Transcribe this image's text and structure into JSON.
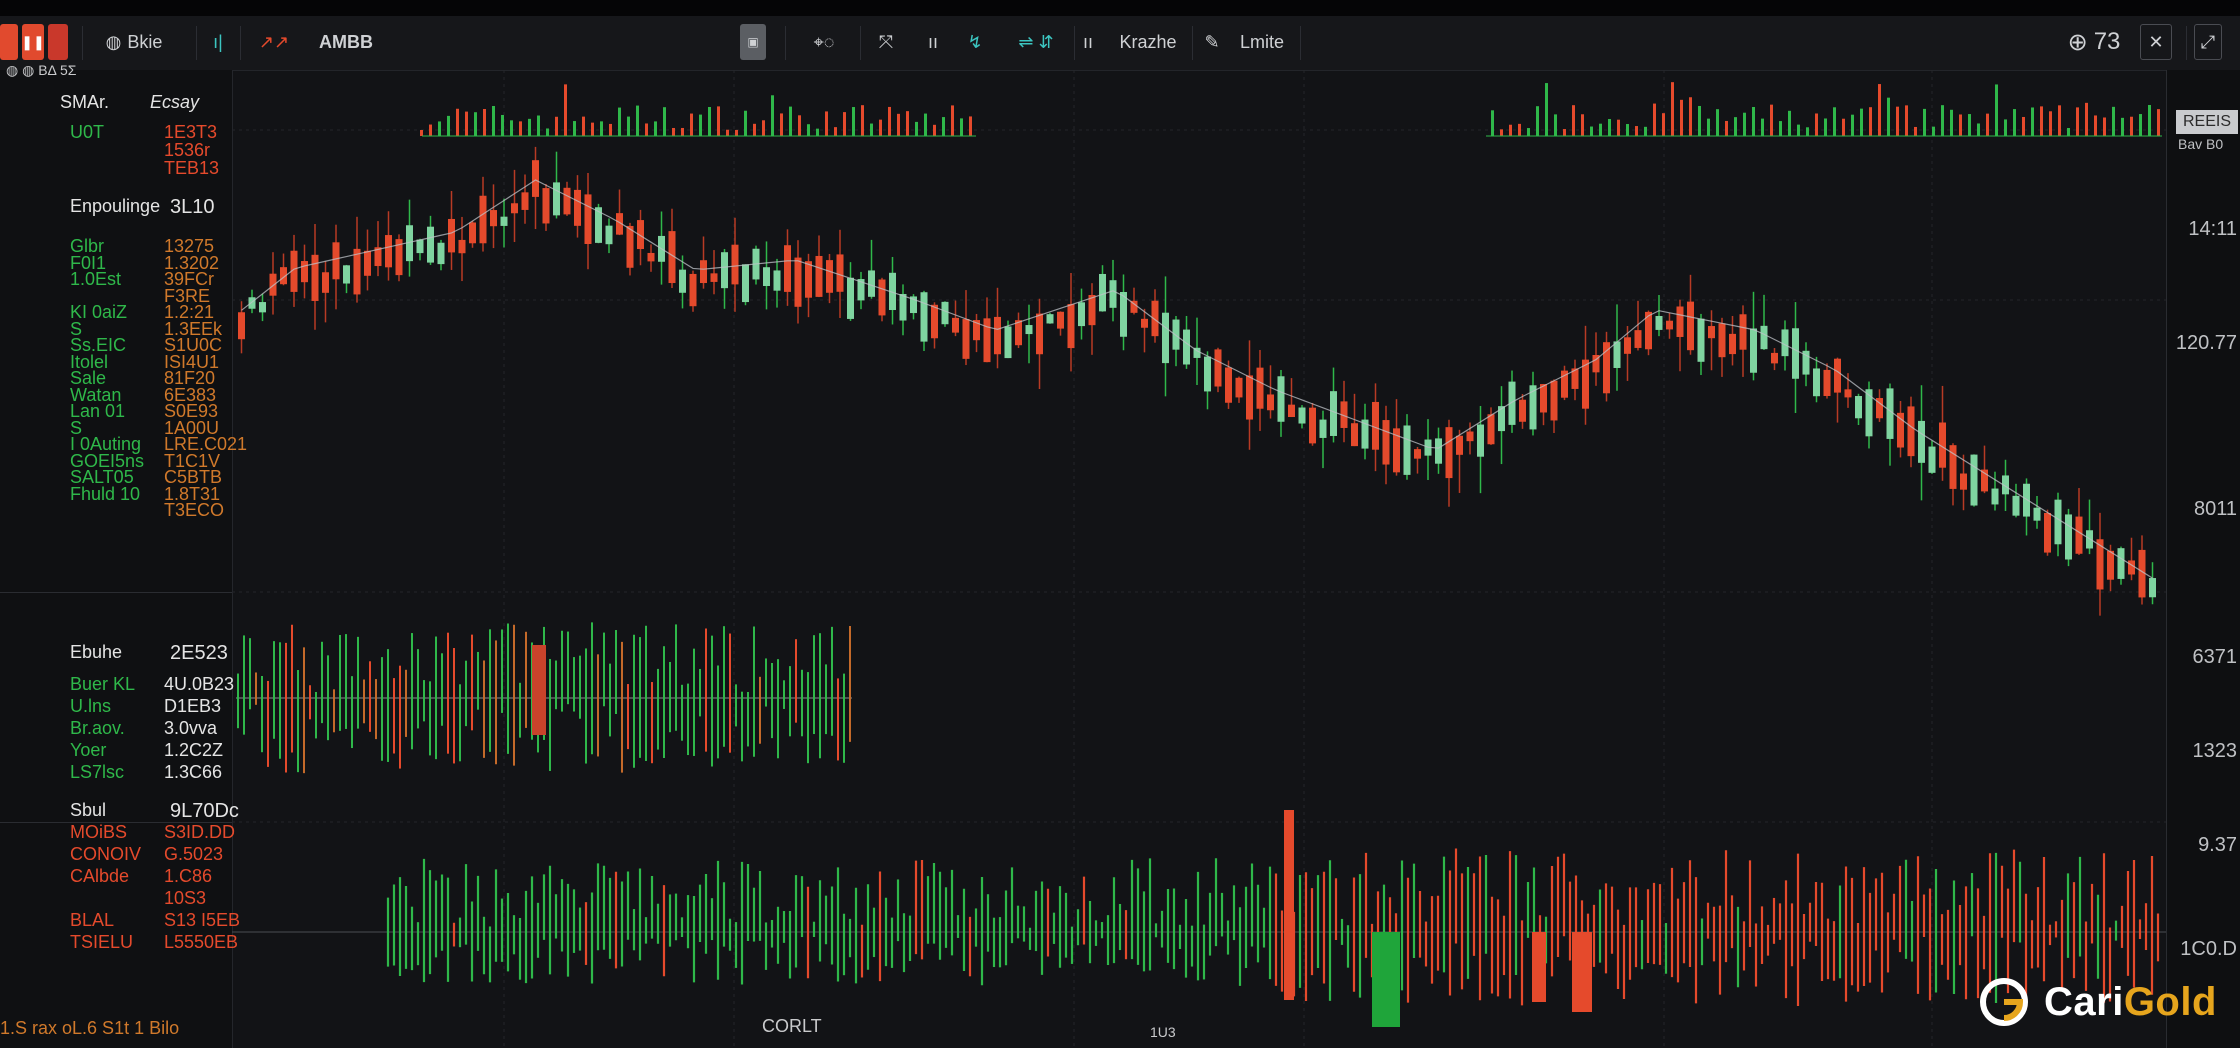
{
  "toolbar": {
    "symbol": "Bkie",
    "interval": "AMBB",
    "text_tool_1": "Krazhe",
    "text_tool_2": "Lmite",
    "zoom": "73"
  },
  "sidebar": {
    "header_left": "SMAr.",
    "header_right": "Ecsay",
    "rows_top": [
      {
        "label": "U0T",
        "value": "1E3T3"
      },
      {
        "label": "",
        "value": "1536r"
      },
      {
        "label": "",
        "value": "TEB13"
      }
    ],
    "section_title": "Enpoulinge",
    "section_value": "3L10",
    "rows_mid": [
      {
        "label": "Glbr",
        "value": "13275"
      },
      {
        "label": "F0I1",
        "value": "1.3202"
      },
      {
        "label": "1.0Est",
        "value": "39FCr"
      },
      {
        "label": "",
        "value": "F3RE"
      },
      {
        "label": "KI 0aiZ",
        "value": "1.2:21"
      },
      {
        "label": "S",
        "value": "1.3EEk"
      },
      {
        "label": "Ss.EIC",
        "value": "S1U0C"
      },
      {
        "label": "Itolel",
        "value": "ISI4U1"
      },
      {
        "label": "Sale",
        "value": "81F20"
      },
      {
        "label": "Watan",
        "value": "6E383"
      },
      {
        "label": "Lan 01",
        "value": "S0E93"
      },
      {
        "label": "S",
        "value": "1A00U"
      },
      {
        "label": "I 0Auting",
        "value": "LRE.C021"
      },
      {
        "label": "GOEI5ns",
        "value": "T1C1V"
      },
      {
        "label": "SALT05",
        "value": "C5BTB"
      },
      {
        "label": "Fhuld 10",
        "value": "1.8T31"
      },
      {
        "label": "",
        "value": "T3ECO"
      }
    ],
    "section2_title": "Ebuhe",
    "section2_value": "2E523",
    "rows_low": [
      {
        "label": "Buer KL",
        "value": "4U.0B23"
      },
      {
        "label": "U.lns",
        "value": "D1EB3"
      },
      {
        "label": "Br.aov.",
        "value": "3.0vva"
      },
      {
        "label": "Yoer",
        "value": "1.2C2Z"
      },
      {
        "label": "LS7lsc",
        "value": "1.3C66"
      }
    ],
    "section3_title": "Sbul",
    "section3_value": "9L70Dc",
    "rows_bottom": [
      {
        "label": "MOiBS",
        "value": "S3ID.DD"
      },
      {
        "label": "CONOIV",
        "value": "G.5023"
      },
      {
        "label": "CAlbde",
        "value": "1.C86"
      },
      {
        "label": "",
        "value": "10S3"
      },
      {
        "label": "BLAL",
        "value": "S13 I5EB"
      },
      {
        "label": "TSIELU",
        "value": "L5550EB"
      }
    ],
    "footer": "1.S rax oL.6 S1t 1 Bilo"
  },
  "price_axis": {
    "tag": "REEIS",
    "tag_sub": "Bav B0",
    "labels": [
      "14:11",
      "120.77",
      "8011",
      "6371",
      "1323",
      "9.37",
      "1C0.D"
    ]
  },
  "bottom_axis": {
    "label": "CORLT",
    "label2": "1U3"
  },
  "logo": {
    "name_white": "Cari",
    "name_gold": "Gold"
  },
  "colors": {
    "background": "#121316",
    "bull": "#7fd4a0",
    "bull_dark": "#2fb84a",
    "bear": "#e54a2c",
    "grid": "#24262b",
    "gold": "#e6a51d"
  }
}
